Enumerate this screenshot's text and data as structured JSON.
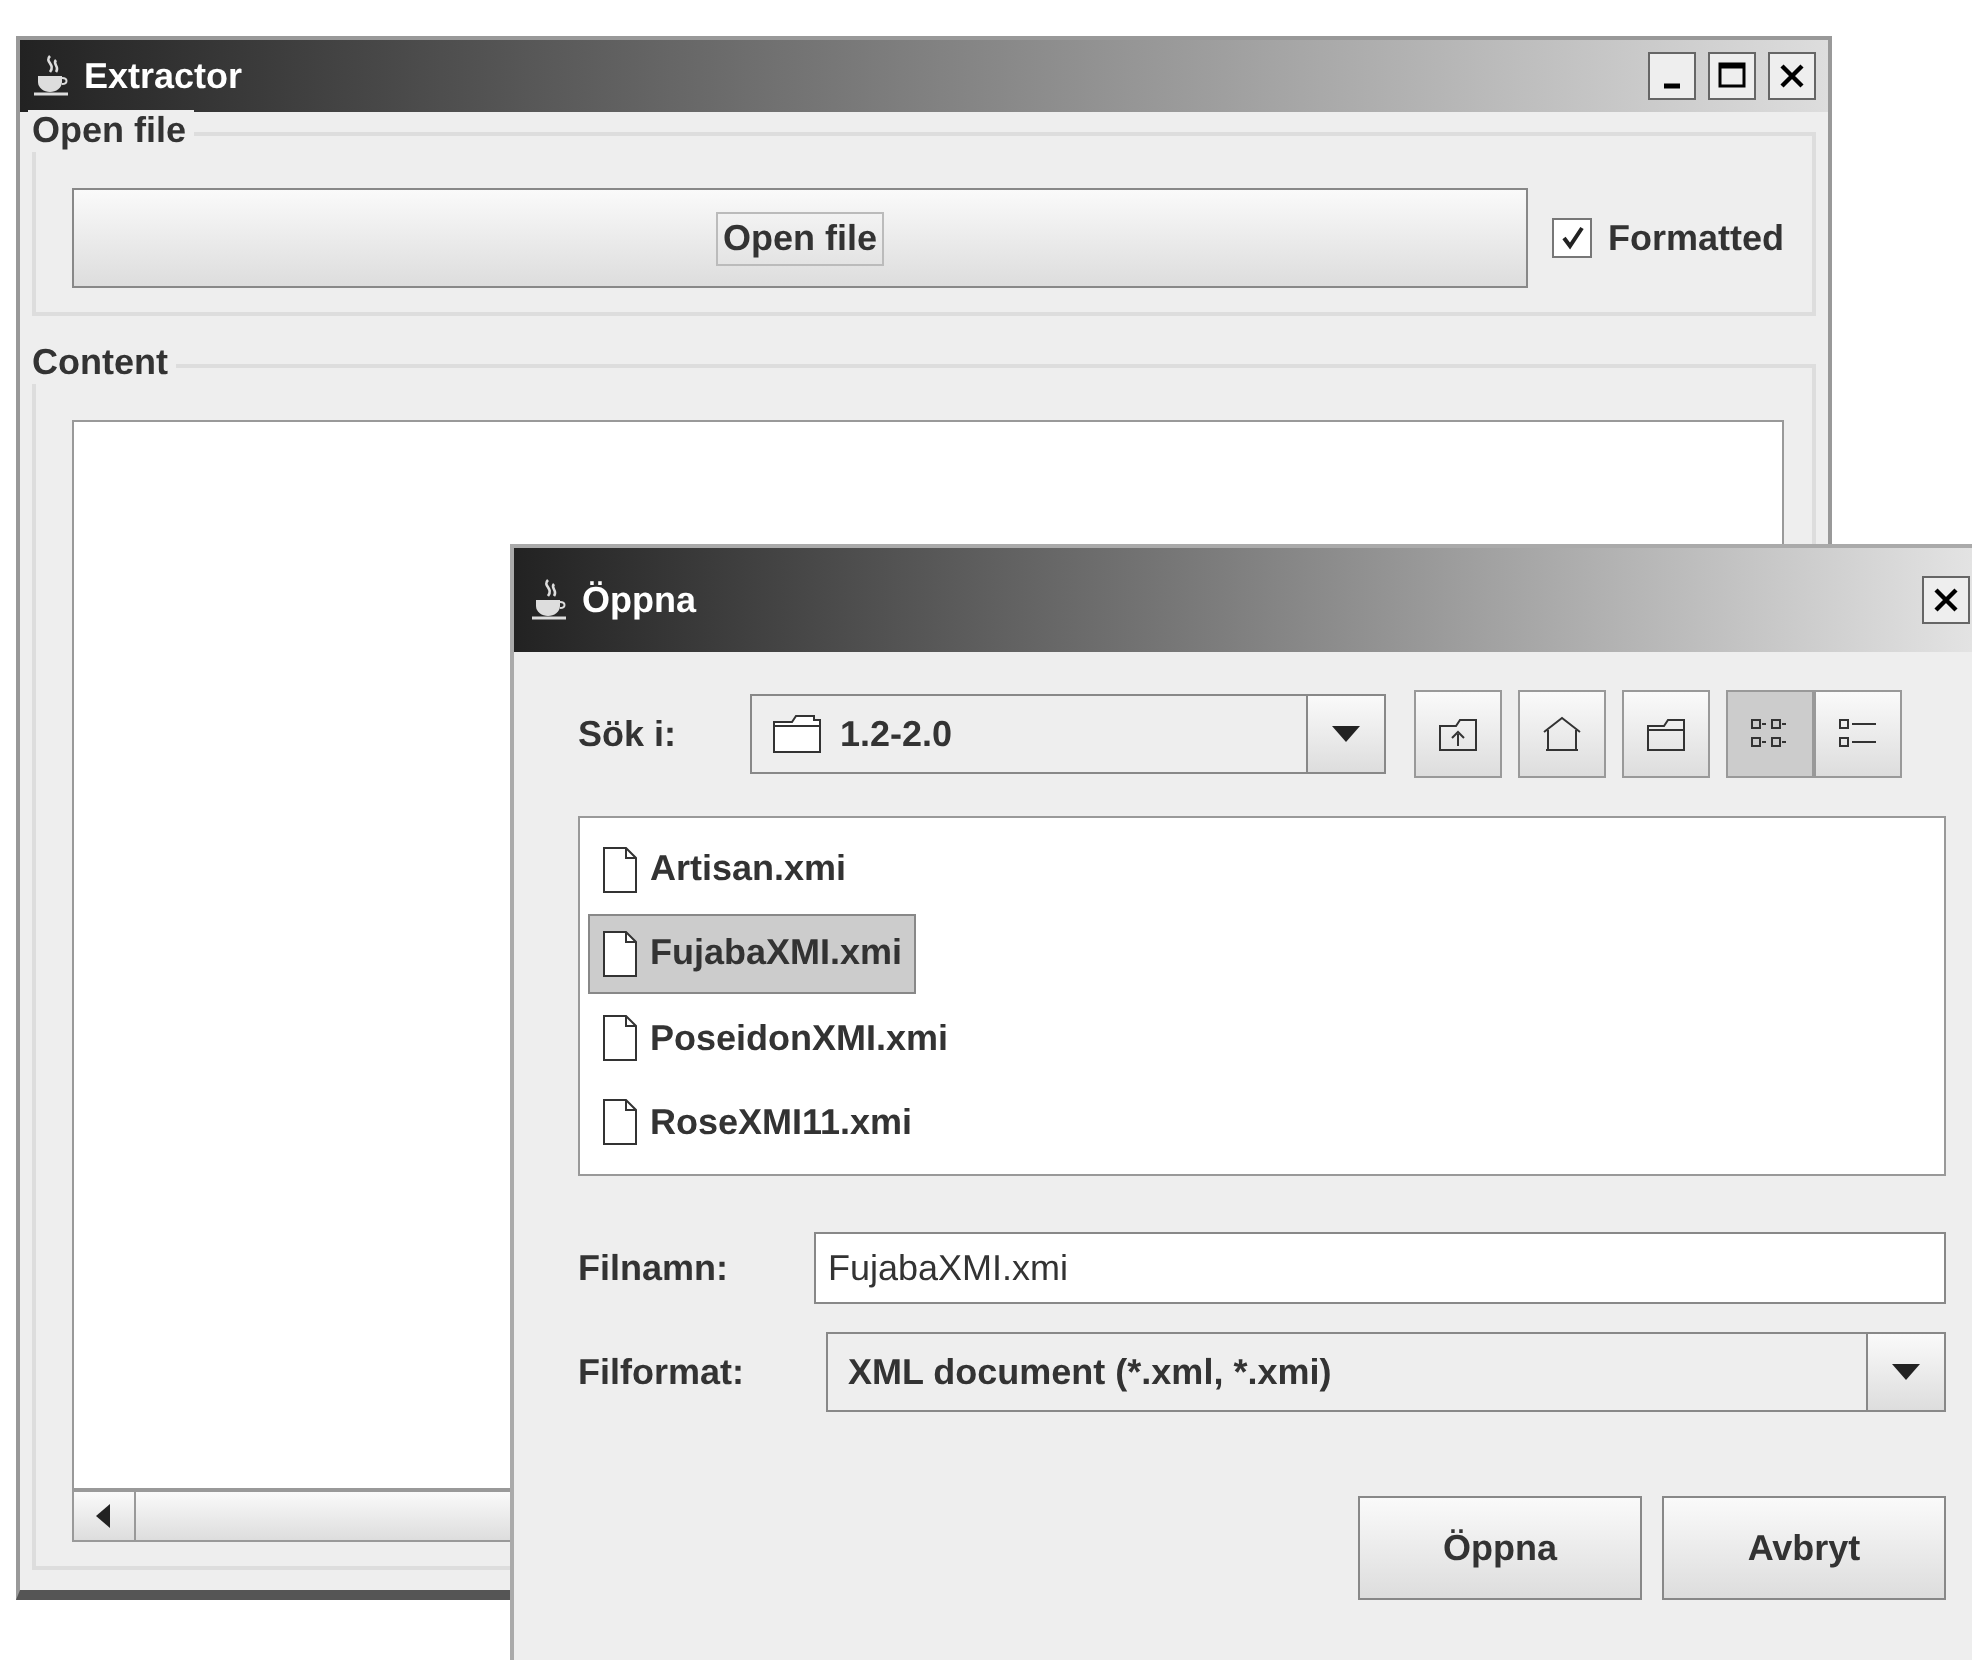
{
  "main_window": {
    "title": "Extractor",
    "open_file_group": {
      "title": "Open file",
      "button": "Open file",
      "checkbox": {
        "label": "Formatted",
        "checked": true
      }
    },
    "content_group": {
      "title": "Content"
    }
  },
  "dialog": {
    "title": "Öppna",
    "look_in": {
      "label": "Sök i:",
      "value": "1.2-2.0"
    },
    "toolbar": [
      {
        "kind": "up",
        "selected": false
      },
      {
        "kind": "home",
        "selected": false
      },
      {
        "kind": "newfolder",
        "selected": false
      },
      {
        "kind": "list",
        "selected": true
      },
      {
        "kind": "details",
        "selected": false
      }
    ],
    "files": [
      {
        "name": "Artisan.xmi",
        "selected": false
      },
      {
        "name": "FujabaXMI.xmi",
        "selected": true
      },
      {
        "name": "PoseidonXMI.xmi",
        "selected": false
      },
      {
        "name": "RoseXMI11.xmi",
        "selected": false
      }
    ],
    "file_name": {
      "label": "Filnamn:",
      "value": "FujabaXMI.xmi"
    },
    "file_format": {
      "label": "Filformat:",
      "value": "XML document (*.xml, *.xmi)"
    },
    "buttons": [
      "Öppna",
      "Avbryt"
    ]
  }
}
